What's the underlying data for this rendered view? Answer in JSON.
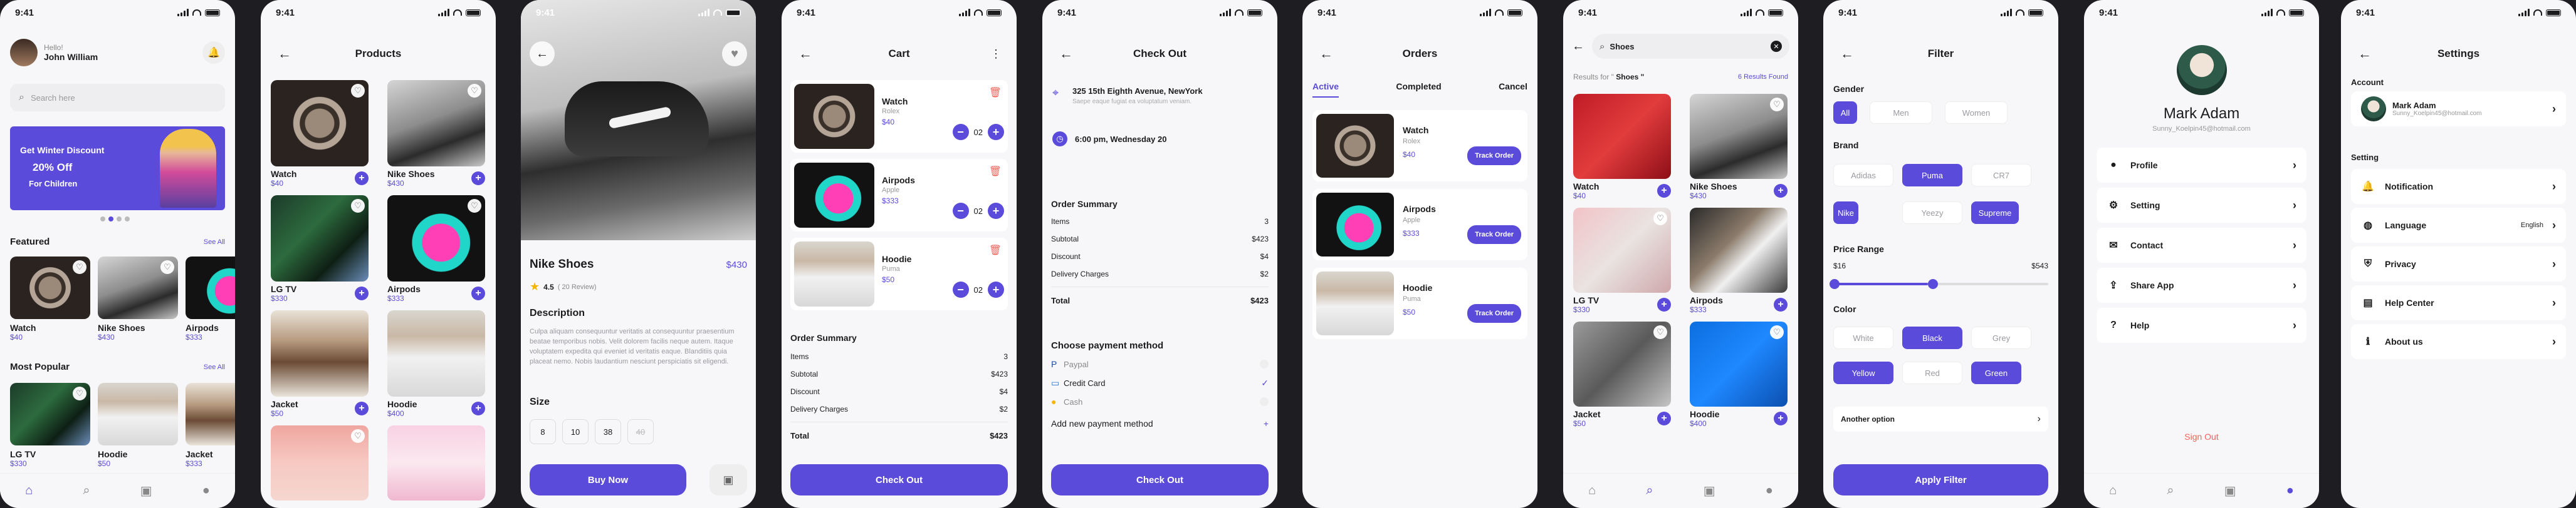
{
  "status_time": "9:41",
  "accent": "#5b4bdb",
  "home": {
    "greeting": "Hello!",
    "user": "John William",
    "search_placeholder": "Search here",
    "banner_title": "Get Winter Discount",
    "banner_discount": "20% Off",
    "banner_sub": "For Children",
    "featured_title": "Featured",
    "see_all": "See All",
    "featured": [
      {
        "name": "Watch",
        "price": "$40"
      },
      {
        "name": "Nike Shoes",
        "price": "$430"
      },
      {
        "name": "Airpods",
        "price": "$333"
      }
    ],
    "popular_title": "Most Popular",
    "popular": [
      {
        "name": "LG TV",
        "price": "$330"
      },
      {
        "name": "Hoodie",
        "price": "$50"
      },
      {
        "name": "Jacket",
        "price": "$333"
      }
    ]
  },
  "products": {
    "title": "Products",
    "items": [
      {
        "name": "Watch",
        "price": "$40"
      },
      {
        "name": "Nike Shoes",
        "price": "$430"
      },
      {
        "name": "LG TV",
        "price": "$330"
      },
      {
        "name": "Airpods",
        "price": "$333"
      },
      {
        "name": "Jacket",
        "price": "$50"
      },
      {
        "name": "Hoodie",
        "price": "$400"
      }
    ]
  },
  "detail": {
    "name": "Nike Shoes",
    "price": "$430",
    "rating": "4.5",
    "reviews": "( 20 Review)",
    "desc_title": "Description",
    "desc": "Culpa aliquam consequuntur veritatis at consequuntur praesentium beatae temporibus nobis. Velit dolorem facilis neque autem. Itaque voluptatem expedita qui eveniet id veritatis eaque. Blanditiis quia placeat nemo. Nobis laudantium nesciunt perspiciatis sit eligendi.",
    "size_title": "Size",
    "sizes": [
      "8",
      "10",
      "38",
      "40"
    ],
    "buy": "Buy Now"
  },
  "cart": {
    "title": "Cart",
    "items": [
      {
        "name": "Watch",
        "brand": "Rolex",
        "price": "$40",
        "qty": "02"
      },
      {
        "name": "Airpods",
        "brand": "Apple",
        "price": "$333",
        "qty": "02"
      },
      {
        "name": "Hoodie",
        "brand": "Puma",
        "price": "$50",
        "qty": "02"
      }
    ],
    "summary_title": "Order Summary",
    "lines": [
      {
        "label": "Items",
        "value": "3"
      },
      {
        "label": "Subtotal",
        "value": "$423"
      },
      {
        "label": "Discount",
        "value": "$4"
      },
      {
        "label": "Delivery Charges",
        "value": "$2"
      }
    ],
    "total_label": "Total",
    "total": "$423",
    "checkout": "Check Out"
  },
  "checkout": {
    "title": "Check Out",
    "address": "325 15th Eighth Avenue, NewYork",
    "address_sub": "Saepe eaque fugiat ea voluptatum veniam.",
    "time": "6:00 pm, Wednesday 20",
    "summary_title": "Order Summary",
    "lines": [
      {
        "label": "Items",
        "value": "3"
      },
      {
        "label": "Subtotal",
        "value": "$423"
      },
      {
        "label": "Discount",
        "value": "$4"
      },
      {
        "label": "Delivery Charges",
        "value": "$2"
      }
    ],
    "total_label": "Total",
    "total": "$423",
    "payment_title": "Choose payment method",
    "methods": [
      "Paypal",
      "Credit Card",
      "Cash"
    ],
    "add_method": "Add new payment method",
    "button": "Check Out"
  },
  "orders": {
    "title": "Orders",
    "tabs": [
      "Active",
      "Completed",
      "Cancel"
    ],
    "items": [
      {
        "name": "Watch",
        "brand": "Rolex",
        "price": "$40"
      },
      {
        "name": "Airpods",
        "brand": "Apple",
        "price": "$333"
      },
      {
        "name": "Hoodie",
        "brand": "Puma",
        "price": "$50"
      }
    ],
    "track": "Track Order"
  },
  "search": {
    "query": "Shoes",
    "results_prefix": "Results for \"",
    "results_term": " Shoes \"",
    "found": "6 Results Found",
    "items": [
      {
        "name": "Watch",
        "price": "$40"
      },
      {
        "name": "Nike Shoes",
        "price": "$430"
      },
      {
        "name": "LG TV",
        "price": "$330"
      },
      {
        "name": "Airpods",
        "price": "$333"
      },
      {
        "name": "Jacket",
        "price": "$50"
      },
      {
        "name": "Hoodie",
        "price": "$400"
      }
    ]
  },
  "filter": {
    "title": "Filter",
    "gender_title": "Gender",
    "genders": [
      "All",
      "Men",
      "Women"
    ],
    "brand_title": "Brand",
    "brands": [
      "Adidas",
      "Puma",
      "CR7",
      "Nike",
      "Yeezy",
      "Supreme"
    ],
    "price_title": "Price Range",
    "price_min": "$16",
    "price_max": "$543",
    "color_title": "Color",
    "colors": [
      "White",
      "Black",
      "Grey",
      "Yellow",
      "Red",
      "Green"
    ],
    "another": "Another option",
    "apply": "Apply Filter"
  },
  "profile": {
    "name": "Mark Adam",
    "email": "Sunny_Koelpin45@hotmail.com",
    "menu": [
      "Profile",
      "Setting",
      "Contact",
      "Share App",
      "Help"
    ],
    "signout": "Sign Out"
  },
  "settings": {
    "title": "Settings",
    "account_title": "Account",
    "name": "Mark Adam",
    "email": "Sunny_Koelpin45@hotmail.com",
    "setting_title": "Setting",
    "items": [
      "Notification",
      "Language",
      "Privacy",
      "Help Center",
      "About us"
    ],
    "language_value": "English"
  }
}
